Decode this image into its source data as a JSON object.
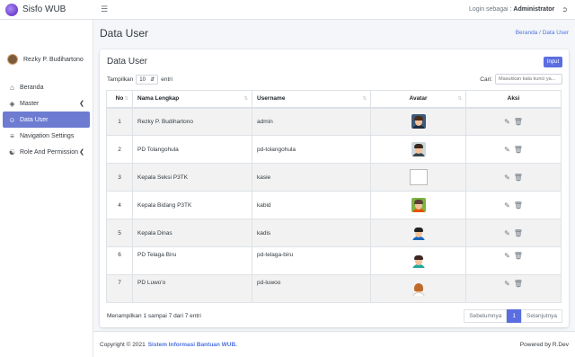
{
  "app": {
    "brand": "Sisfo WUB"
  },
  "topbar": {
    "login_prefix": "Login sebagai :",
    "login_user": "Administrator"
  },
  "sidebar": {
    "user_name": "Rezky P. Budihartono",
    "items": [
      {
        "label": "Beranda",
        "icon": "home-icon"
      },
      {
        "label": "Master",
        "icon": "layers-icon"
      },
      {
        "label": "Data User",
        "icon": "user-icon"
      },
      {
        "label": "Navigation Settings",
        "icon": "menu-icon"
      },
      {
        "label": "Role And Permission",
        "icon": "users-icon"
      }
    ]
  },
  "page": {
    "title": "Data User",
    "breadcrumb": {
      "home": "Beranda",
      "separator": "/",
      "current": "Data User"
    }
  },
  "card": {
    "title": "Data User",
    "input_button": "Input",
    "length_prefix": "Tampilkan",
    "length_value": "10",
    "length_suffix": "entri",
    "search_label": "Cari:",
    "search_placeholder": "Masukkan kata kunci ya..."
  },
  "table": {
    "headers": {
      "no": "No",
      "name": "Nama Lengkap",
      "username": "Username",
      "avatar": "Avatar",
      "aksi": "Aksi"
    },
    "rows": [
      {
        "no": "1",
        "name": "Rezky P. Budihartono",
        "username": "admin"
      },
      {
        "no": "2",
        "name": "PD Tolangohula",
        "username": "pd-tolangohula"
      },
      {
        "no": "3",
        "name": "Kepala Seksi P3TK",
        "username": "kasie"
      },
      {
        "no": "4",
        "name": "Kepala Bidang P3TK",
        "username": "kabid"
      },
      {
        "no": "5",
        "name": "Kepala Dinas",
        "username": "kadis"
      },
      {
        "no": "6",
        "name": "PD Telaga Biru",
        "username": "pd-telaga-biru"
      },
      {
        "no": "7",
        "name": "PD Luwo'o",
        "username": "pd-luwoo"
      }
    ]
  },
  "pagination": {
    "info": "Menampilkan 1 sampai 7 dari 7 entri",
    "prev": "Sebelumnya",
    "current": "1",
    "next": "Selanjutnya"
  },
  "footer": {
    "copyright": "Copyright © 2021",
    "link": "Sistem Informasi Bantuan WUB.",
    "powered": "Powered by R.Dev"
  },
  "colors": {
    "primary": "#5b6ee1",
    "active_menu": "#6d7cd1",
    "link": "#4e73df"
  }
}
